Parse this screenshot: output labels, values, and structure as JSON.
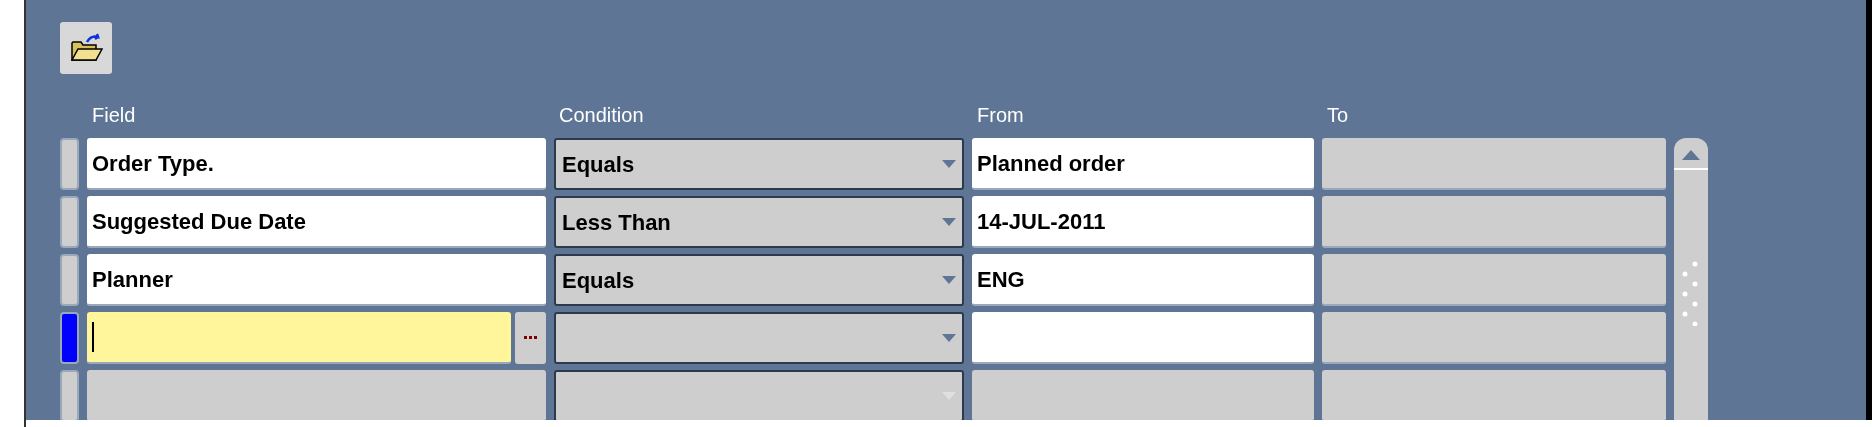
{
  "toolbar": {
    "buttons": [
      {
        "kind": "open-folder"
      }
    ]
  },
  "table": {
    "columns": [
      "Field",
      "Condition",
      "From",
      "To"
    ],
    "rows": [
      {
        "selected": false,
        "field": {
          "value": "Order Type.",
          "focused": false,
          "disabled": false
        },
        "condition": {
          "value": "Equals",
          "disabled": false
        },
        "from": {
          "value": "Planned order",
          "disabled": false
        },
        "to": {
          "disabled": true
        }
      },
      {
        "selected": false,
        "field": {
          "value": "Suggested Due Date",
          "focused": false,
          "disabled": false
        },
        "condition": {
          "value": "Less Than",
          "disabled": false
        },
        "from": {
          "value": "14-JUL-2011",
          "disabled": false
        },
        "to": {
          "disabled": true
        }
      },
      {
        "selected": false,
        "field": {
          "value": "Planner",
          "focused": false,
          "disabled": false
        },
        "condition": {
          "value": "Equals",
          "disabled": false
        },
        "from": {
          "value": "ENG",
          "disabled": false
        },
        "to": {
          "disabled": true
        }
      },
      {
        "selected": true,
        "field": {
          "focused": true,
          "disabled": false
        },
        "condition": {
          "disabled": false
        },
        "from": {
          "disabled": false
        },
        "to": {
          "disabled": true
        }
      },
      {
        "selected": false,
        "field": {
          "focused": false,
          "disabled": true
        },
        "condition": {
          "disabled": true
        },
        "from": {
          "disabled": true
        },
        "to": {
          "disabled": true
        }
      }
    ]
  }
}
